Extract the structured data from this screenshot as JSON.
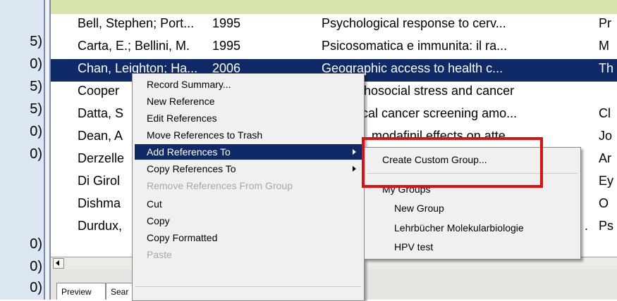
{
  "left_pane": {
    "partial_counts": [
      "5)",
      "0)",
      "5)",
      "5)",
      "0)",
      "0)",
      "0)",
      "0)",
      "0)"
    ]
  },
  "table": {
    "rows": [
      {
        "author": "Bell, Stephen; Port...",
        "year": "1995",
        "title": "Psychological response to cerv...",
        "extra": "Pr"
      },
      {
        "author": "Carta, E.; Bellini, M.",
        "year": "1995",
        "title": "Psicosomatica e immunita: il ra...",
        "extra": "M"
      },
      {
        "author": "Chan, Leighton; Ha...",
        "year": "2006",
        "title": "Geographic access to health c...",
        "extra": "Th"
      },
      {
        "author": "Cooper",
        "year": "",
        "title": "hosocial stress and cancer",
        "extra": ""
      },
      {
        "author": "Datta, S",
        "year": "",
        "title": "cal cancer screening amo...",
        "extra": "Cl"
      },
      {
        "author": "Dean, A",
        "year": "",
        "title": "modafinil effects on atte...",
        "extra": "Jo"
      },
      {
        "author": "Derzelle",
        "year": "",
        "title": "",
        "extra": "Ar"
      },
      {
        "author": "Di Girol",
        "year": "",
        "title": "",
        "extra": "Ey"
      },
      {
        "author": "Dishma",
        "year": "",
        "title": "",
        "extra": "O"
      },
      {
        "author": "Durdux,",
        "year": "",
        "title": ".",
        "extra": "Ps"
      }
    ]
  },
  "tabs": [
    "Preview",
    "Sear"
  ],
  "context_menu": {
    "items": [
      {
        "label": "Record Summary...",
        "disabled": false
      },
      {
        "label": "New Reference",
        "disabled": false
      },
      {
        "label": "Edit References",
        "disabled": false
      },
      {
        "label": "Move References to Trash",
        "disabled": false
      },
      {
        "label": "Add References To",
        "disabled": false,
        "submenu": true,
        "highlighted": true
      },
      {
        "label": "Copy References To",
        "disabled": false,
        "submenu": true
      },
      {
        "label": "Remove References From Group",
        "disabled": true
      },
      {
        "label": "Cut",
        "disabled": false
      },
      {
        "label": "Copy",
        "disabled": false
      },
      {
        "label": "Copy Formatted",
        "disabled": false
      },
      {
        "label": "Paste",
        "disabled": true
      }
    ]
  },
  "submenu": {
    "create_label": "Create Custom Group...",
    "section_label": "My Groups",
    "groups": [
      "New Group",
      "Lehrbücher Molekularbiologie",
      "HPV test"
    ]
  },
  "colors": {
    "selection": "#0f2a67",
    "highlight_box": "#e01010"
  }
}
